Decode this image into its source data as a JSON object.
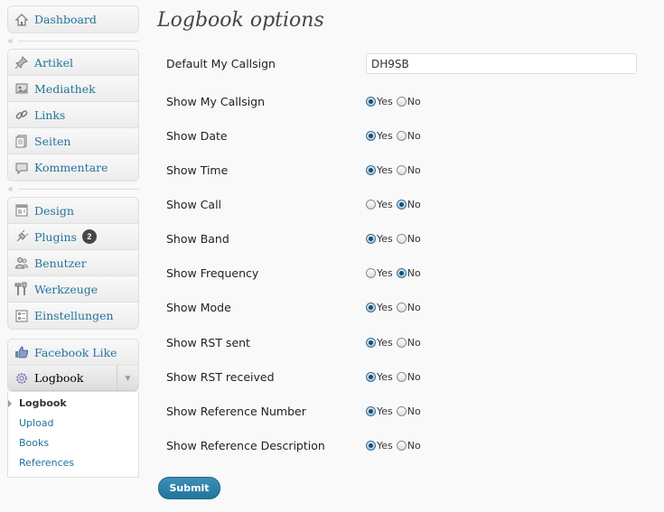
{
  "sidebar": {
    "group1": [
      {
        "label": "Dashboard",
        "icon": "dashboard-icon"
      }
    ],
    "group2": [
      {
        "label": "Artikel",
        "icon": "pin-icon"
      },
      {
        "label": "Mediathek",
        "icon": "media-icon"
      },
      {
        "label": "Links",
        "icon": "link-icon"
      },
      {
        "label": "Seiten",
        "icon": "pages-icon"
      },
      {
        "label": "Kommentare",
        "icon": "comment-icon"
      }
    ],
    "group3": [
      {
        "label": "Design",
        "icon": "design-icon"
      },
      {
        "label": "Plugins",
        "icon": "plugin-icon",
        "badge": "2"
      },
      {
        "label": "Benutzer",
        "icon": "users-icon"
      },
      {
        "label": "Werkzeuge",
        "icon": "tools-icon"
      },
      {
        "label": "Einstellungen",
        "icon": "settings-icon"
      }
    ],
    "group4": [
      {
        "label": "Facebook Like",
        "icon": "thumbs-up-icon"
      }
    ],
    "current": {
      "label": "Logbook",
      "icon": "gear-icon"
    },
    "submenu": [
      "Logbook",
      "Upload",
      "Books",
      "References"
    ]
  },
  "page": {
    "title": "Logbook options",
    "callsign_label": "Default My Callsign",
    "callsign_value": "DH9SB",
    "yes": "Yes",
    "no": "No",
    "options": [
      {
        "label": "Show My Callsign",
        "value": "Yes"
      },
      {
        "label": "Show Date",
        "value": "Yes"
      },
      {
        "label": "Show Time",
        "value": "Yes"
      },
      {
        "label": "Show Call",
        "value": "No"
      },
      {
        "label": "Show Band",
        "value": "Yes"
      },
      {
        "label": "Show Frequency",
        "value": "No"
      },
      {
        "label": "Show Mode",
        "value": "Yes"
      },
      {
        "label": "Show RST sent",
        "value": "Yes"
      },
      {
        "label": "Show RST received",
        "value": "Yes"
      },
      {
        "label": "Show Reference Number",
        "value": "Yes"
      },
      {
        "label": "Show Reference Description",
        "value": "Yes"
      }
    ],
    "submit_label": "Submit"
  },
  "colors": {
    "link": "#21759b",
    "button": "#21759b"
  }
}
